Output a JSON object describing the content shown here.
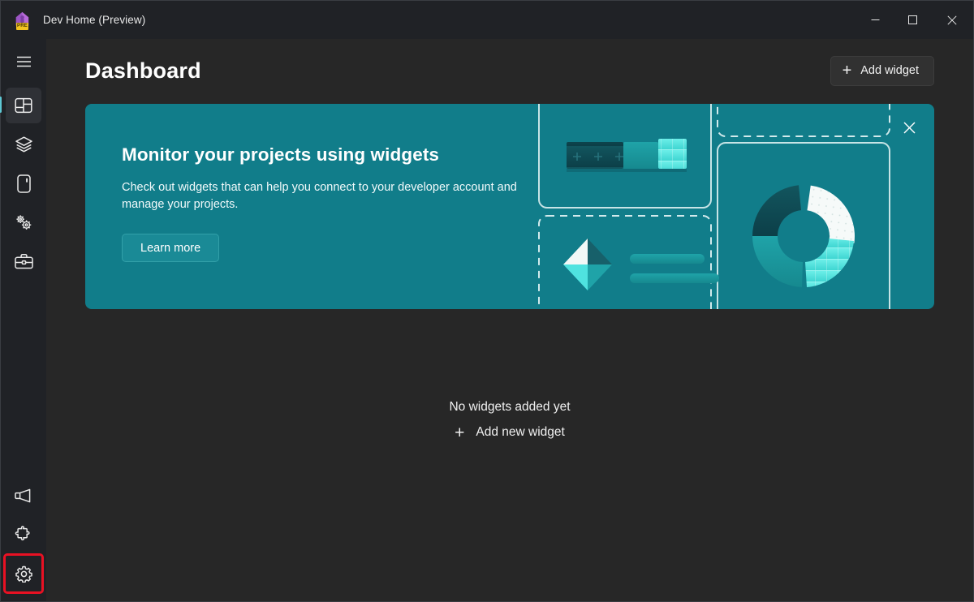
{
  "window": {
    "app_icon_name": "dev-home-house-icon",
    "app_icon_badge": "PRE",
    "title": "Dev Home (Preview)",
    "controls": [
      {
        "name": "minimize-button",
        "glyph": "minimize-icon"
      },
      {
        "name": "maximize-button",
        "glyph": "maximize-icon"
      },
      {
        "name": "close-button",
        "glyph": "close-icon"
      }
    ]
  },
  "sidebar": {
    "menu_label": "Navigation menu",
    "items": [
      {
        "name": "dashboard",
        "icon": "dashboard-icon",
        "label": "Dashboard",
        "selected": true
      },
      {
        "name": "machine-configuration",
        "icon": "layers-icon",
        "label": "Machine configuration",
        "selected": false
      },
      {
        "name": "environments",
        "icon": "device-icon",
        "label": "Environments",
        "selected": false
      },
      {
        "name": "utilities",
        "icon": "gears-icon",
        "label": "Utilities",
        "selected": false
      },
      {
        "name": "dev-insights",
        "icon": "toolbox-icon",
        "label": "Dev insights",
        "selected": false
      }
    ],
    "bottom_items": [
      {
        "name": "feedback",
        "icon": "megaphone-icon",
        "label": "Feedback",
        "annotated": false
      },
      {
        "name": "extensions",
        "icon": "puzzle-icon",
        "label": "Extensions",
        "annotated": false
      },
      {
        "name": "settings",
        "icon": "gear-icon",
        "label": "Settings",
        "annotated": true
      }
    ],
    "annotation_color": "#e81123"
  },
  "header": {
    "title": "Dashboard",
    "add_widget_label": "Add widget",
    "add_widget_plus": "+"
  },
  "banner": {
    "title": "Monitor your projects using widgets",
    "description": "Check out widgets that can help you connect to your developer account and manage your projects.",
    "learn_more_label": "Learn more",
    "close_label": "Close",
    "background_color": "#117d8a",
    "accent_light": "#4fe3e0",
    "accent_dark": "#0d4d55"
  },
  "empty_state": {
    "title": "No widgets added yet",
    "add_label": "Add new widget",
    "add_plus": "+"
  }
}
